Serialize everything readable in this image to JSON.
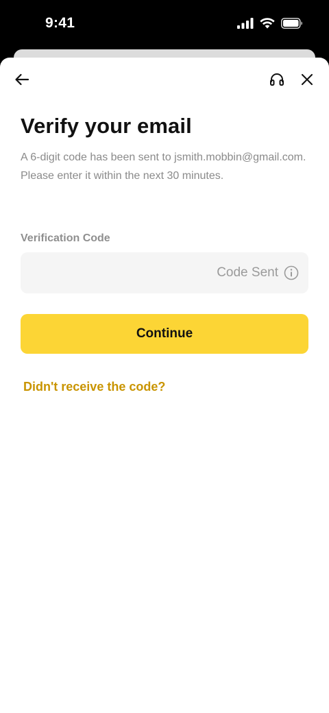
{
  "status_bar": {
    "time": "9:41"
  },
  "header": {
    "back_icon": "arrow-left-icon",
    "support_icon": "headset-icon",
    "close_icon": "close-icon"
  },
  "main": {
    "title": "Verify your email",
    "description": "A 6-digit code has been sent to jsmith.mobbin@gmail.com. Please enter it within the next 30 minutes.",
    "field": {
      "label": "Verification Code",
      "value": "",
      "placeholder": "",
      "status_text": "Code Sent",
      "status_icon": "info-icon"
    },
    "continue_label": "Continue",
    "resend_label": "Didn't receive the code?"
  },
  "colors": {
    "primary_button": "#fcd535",
    "link": "#c99400",
    "input_background": "#f5f5f5",
    "muted_text": "#8a8a8a"
  }
}
